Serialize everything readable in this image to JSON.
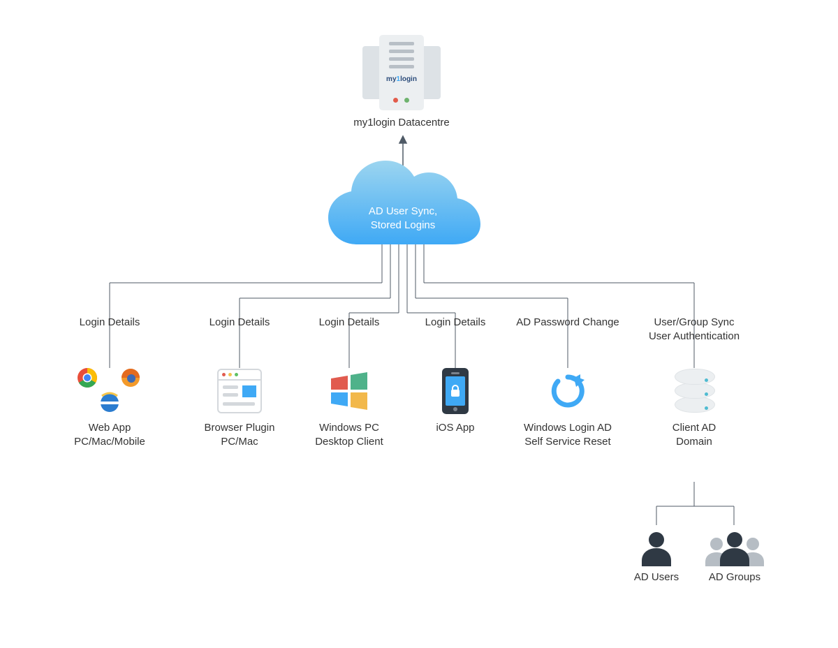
{
  "root": {
    "brand_prefix": "my",
    "brand_one": "1",
    "brand_suffix": "login",
    "caption": "my1login Datacentre"
  },
  "cloud": {
    "line1": "AD User Sync,",
    "line2": "Stored Logins"
  },
  "branches": [
    {
      "label": "Login Details"
    },
    {
      "label": "Login Details"
    },
    {
      "label": "Login Details"
    },
    {
      "label": "Login Details"
    },
    {
      "label": "AD Password Change"
    },
    {
      "label_line1": "User/Group Sync",
      "label_line2": "User Authentication"
    }
  ],
  "leaves": {
    "webapp": {
      "line1": "Web App",
      "line2": "PC/Mac/Mobile"
    },
    "plugin": {
      "line1": "Browser Plugin",
      "line2": "PC/Mac"
    },
    "desktop": {
      "line1": "Windows PC",
      "line2": "Desktop Client"
    },
    "ios": {
      "line1": "iOS App"
    },
    "adreset": {
      "line1": "Windows Login AD",
      "line2": "Self Service Reset"
    },
    "addomain": {
      "line1": "Client AD",
      "line2": "Domain"
    }
  },
  "sub": {
    "users": {
      "label": "AD Users"
    },
    "groups": {
      "label": "AD Groups"
    }
  },
  "colors": {
    "connector": "#4f5a66",
    "text": "#333333",
    "cloud_top": "#7fc7ea",
    "cloud_bottom": "#3fa9f5",
    "accent": "#3fa9f5",
    "dark": "#2f3944",
    "light": "#eceff1",
    "muted": "#b6bdc4"
  }
}
